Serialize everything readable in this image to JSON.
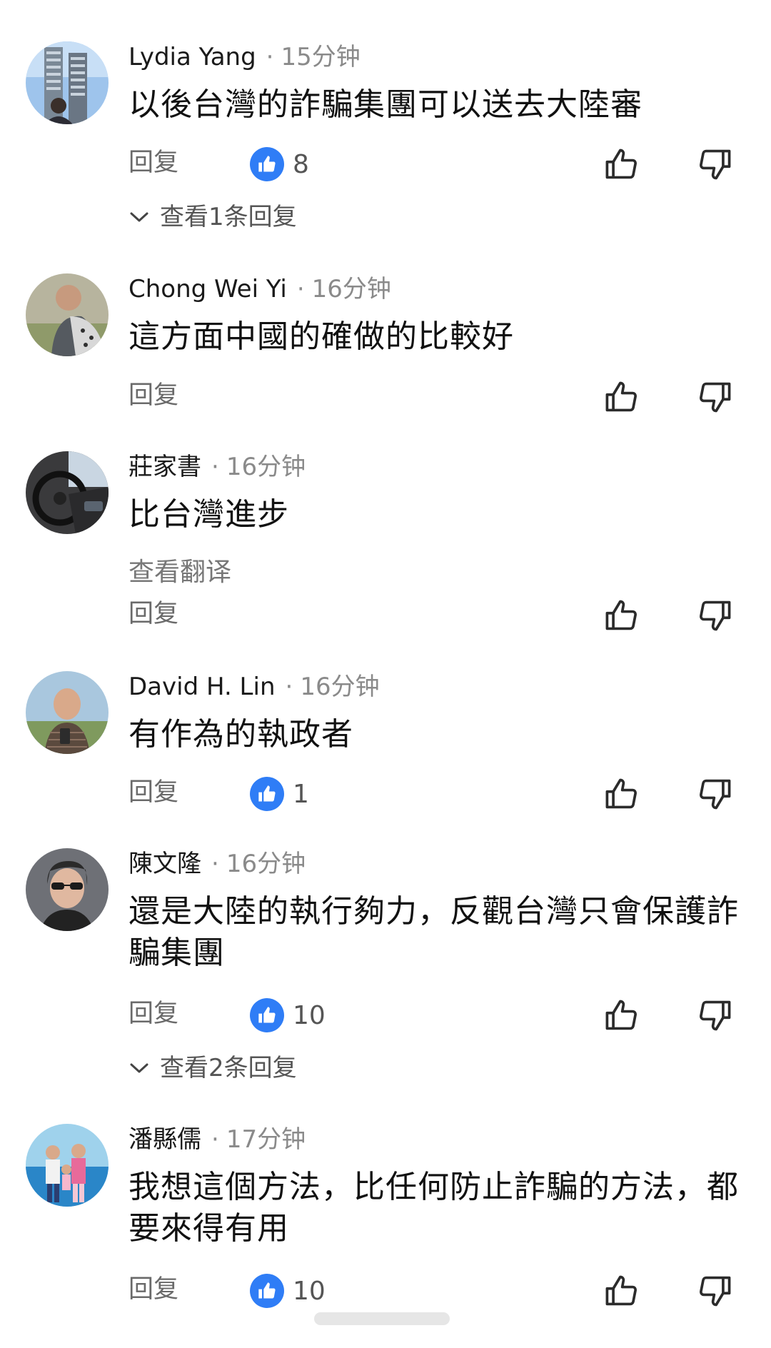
{
  "comments": [
    {
      "name": "Lydia Yang",
      "dot": "·",
      "time": "15分钟",
      "text": "以後台灣的詐騙集團可以送去大陸審",
      "reply_label": "回复",
      "likes": "8",
      "view_replies": "查看1条回复"
    },
    {
      "name": "Chong Wei Yi",
      "dot": "·",
      "time": "16分钟",
      "text": "這方面中國的確做的比較好",
      "reply_label": "回复"
    },
    {
      "name": "莊家書",
      "dot": "·",
      "time": "16分钟",
      "text": "比台灣進步",
      "translate": "查看翻译",
      "reply_label": "回复"
    },
    {
      "name": "David H. Lin",
      "dot": "·",
      "time": "16分钟",
      "text": "有作為的執政者",
      "reply_label": "回复",
      "likes": "1"
    },
    {
      "name": "陳文隆",
      "dot": "·",
      "time": "16分钟",
      "text": "還是大陸的執行夠力，反觀台灣只會保護詐騙集團",
      "reply_label": "回复",
      "likes": "10",
      "view_replies": "查看2条回复"
    },
    {
      "name": "潘縣儒",
      "dot": "·",
      "time": "17分钟",
      "text": "我想這個方法，比任何防止詐騙的方法，都要來得有用",
      "reply_label": "回复",
      "likes": "10"
    }
  ],
  "colors": {
    "like_badge": "#2f7df6",
    "meta_gray": "#8a8a8a",
    "icon_stroke": "#2b2b2b"
  },
  "icons": {
    "like_badge": "thumbs-up-filled-icon",
    "thumb_up": "thumbs-up-outline-icon",
    "thumb_down": "thumbs-down-outline-icon",
    "expand": "chevron-down-icon"
  }
}
